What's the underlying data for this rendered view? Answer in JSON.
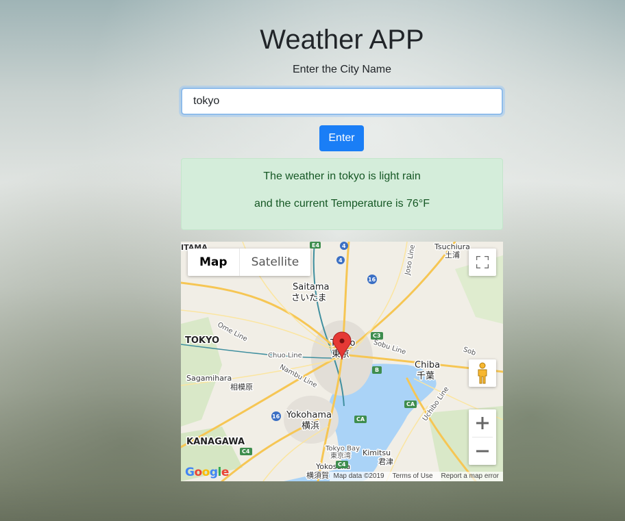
{
  "app": {
    "title": "Weather APP",
    "subtitle": "Enter the City Name",
    "input_value": "tokyo",
    "button_label": "Enter"
  },
  "result": {
    "line1": "The weather in tokyo is light rain",
    "line2": "and the current Temperature is 76°F"
  },
  "map": {
    "type_control": {
      "map_label": "Map",
      "satellite_label": "Satellite",
      "selected": "Map"
    },
    "labels": {
      "itama": "ITAMA",
      "tsuchiura": "Tsuchiura",
      "tsuchiura_jp": "土浦",
      "joso_line": "Joso Line",
      "saitama": "Saitama",
      "saitama_jp": "さいたま",
      "tokyo_pref": "TOKYO",
      "ome_line": "Ome Line",
      "tokyo": "Tokyo",
      "tokyo_jp": "東京",
      "chuo_line": "Chuo Line",
      "sobu_line": "Sobu Line",
      "chiba": "Chiba",
      "chiba_jp": "千葉",
      "sagamihara": "Sagamihara",
      "sagamihara_jp": "相模原",
      "nambu_line": "Nambu Line",
      "yokohama": "Yokohama",
      "yokohama_jp": "横浜",
      "uchibo_line": "Uchibo Line",
      "kanagawa": "KANAGAWA",
      "tokyo_bay": "Tokyo Bay",
      "tokyo_bay_jp": "東京湾",
      "kimitsu": "Kimitsu",
      "kimitsu_jp": "君津",
      "yokosuka": "Yokosuka",
      "yokosuka_jp": "横須賀",
      "sob": "Sob"
    },
    "shields": {
      "e4": "E4",
      "r4a": "4",
      "r4b": "4",
      "r16a": "16",
      "r16b": "16",
      "c3": "C3",
      "b": "B",
      "ca1": "CA",
      "ca2": "CA",
      "c4a": "C4",
      "c4b": "C4"
    },
    "logo": "Google",
    "footer": {
      "data": "Map data ©2019",
      "terms": "Terms of Use",
      "report": "Report a map error"
    }
  }
}
